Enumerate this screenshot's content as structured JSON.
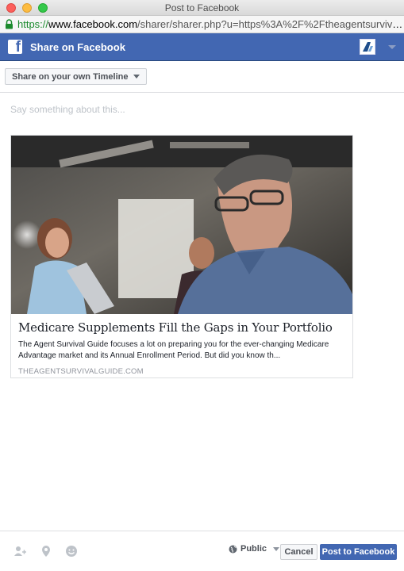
{
  "window": {
    "title": "Post to Facebook"
  },
  "urlbar": {
    "scheme": "https://",
    "host": "www.facebook.com",
    "rest": "/sharer/sharer.php?u=https%3A%2F%2Ftheagentsurvivalguide..."
  },
  "header": {
    "title": "Share on Facebook"
  },
  "audience": {
    "label": "Share on your own Timeline"
  },
  "composer": {
    "placeholder": "Say something about this..."
  },
  "preview": {
    "title": "Medicare Supplements Fill the Gaps in Your Portfolio",
    "description_line1": "The Agent Survival Guide focuses a lot on preparing you for the ever-changing Medicare",
    "description_line2": "Advantage market and its Annual Enrollment Period. But did you know th...",
    "domain": "THEAGENTSURVIVALGUIDE.COM"
  },
  "footer": {
    "privacy_label": "Public",
    "cancel_label": "Cancel",
    "post_label": "Post to Facebook"
  },
  "colors": {
    "brand": "#4267b2",
    "secure": "#1b8a2d"
  }
}
